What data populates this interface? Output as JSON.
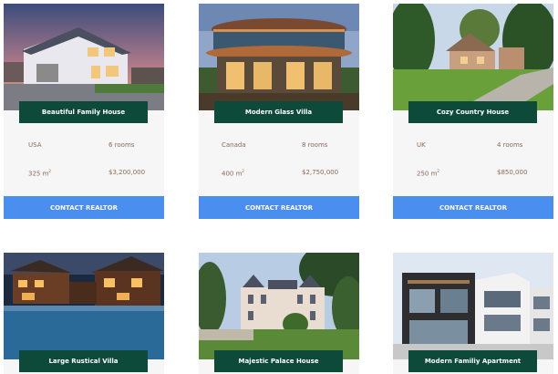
{
  "listings": [
    {
      "title": "Beautiful Family House",
      "country": "USA",
      "rooms": "6 rooms",
      "area": "325 m",
      "area_unit_sup": "2",
      "price": "$3,200,000",
      "contact_label": "CONTACT REALTOR"
    },
    {
      "title": "Modern Glass Villa",
      "country": "Canada",
      "rooms": "8 rooms",
      "area": "400 m",
      "area_unit_sup": "2",
      "price": "$2,750,000",
      "contact_label": "CONTACT REALTOR"
    },
    {
      "title": "Cozy Country House",
      "country": "UK",
      "rooms": "4 rooms",
      "area": "250 m",
      "area_unit_sup": "2",
      "price": "$850,000",
      "contact_label": "CONTACT REALTOR"
    },
    {
      "title": "Large Rustical Villa"
    },
    {
      "title": "Majestic Palace House"
    },
    {
      "title": "Modern Familiy Apartment"
    }
  ],
  "colors": {
    "title_bg": "#0d4a3a",
    "button_bg": "#4a8ef0",
    "detail_text": "#8a6a55"
  }
}
